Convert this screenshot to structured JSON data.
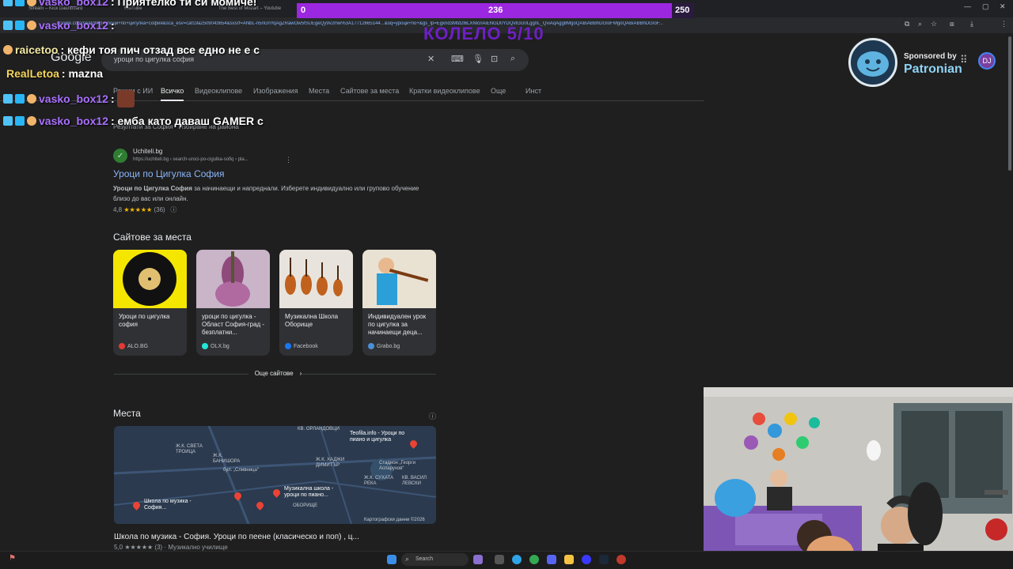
{
  "browser": {
    "tabs": [
      "Stream – Kick Dashboard",
      "YouTube",
      "The Best of Mozart – Youtube"
    ],
    "url": "google.com/search?q=уроци+по+цигулка+софия&sca_esv=caf19a2509043654&sxsrf=ANbL-n5nGnYqAgZRawOw5fSUEgeQy9v2mw%3A17712665144...&oq=уроци+по+&gs_lp=Egxnd3Mtd2l6LXNlcnAiENGD0YDQvtGG0Lgg0L_QviAqAgg8MgoQABiABBhDGIoFMgoQABiABBhDGIoF..."
  },
  "search": {
    "logo": "Google",
    "query": "уроци по цигулка софия",
    "tabs": [
      "Режим с ИИ",
      "Всичко",
      "Видеоклипове",
      "Изображения",
      "Места",
      "Сайтове за места",
      "Кратки видеоклипове",
      "Още",
      "Инст"
    ],
    "results_for": "Резултати за София · Избиране на района"
  },
  "result1": {
    "site": "Uchiteli.bg",
    "url": "https://uchiteli.bg › search-uroci-po-cigulka-sofiq › pla...",
    "title": "Уроци по Цигулка София",
    "snippet_bold": "Уроци по Цигулка София",
    "snippet": " за начинаещи и напреднали. Изберете индивидуално или групово обучение близо до вас или онлайн.",
    "rating_value": "4,8",
    "stars": "★★★★★",
    "rating_count": "(36)"
  },
  "places_sites": {
    "title": "Сайтове за места",
    "cards": [
      {
        "title": "Уроци по цигулка софия",
        "source": "ALO.BG",
        "dot": "#e53935"
      },
      {
        "title": "уроци по цигулка - Област София-град - безплатни...",
        "source": "OLX.bg",
        "dot": "#23e5db"
      },
      {
        "title": "Музикална Школа Оборище",
        "source": "Facebook",
        "dot": "#1877f2"
      },
      {
        "title": "Индивидуален урок по цигулка за начинаещи деца...",
        "source": "Grabo.bg",
        "dot": "#4a90d9"
      }
    ],
    "more": "Още сайтове"
  },
  "places": {
    "title": "Места",
    "map_labels": [
      "КВ. ОРЛАНДОВЦИ",
      "Ж.К. СВЕТА ТРОИЦА",
      "Ж.К. БАНИШОРА",
      "Ж.К. ХАДЖИ ДИМИТЪР",
      "бул. „Сливница“",
      "Стадион „Георги Аспарухов“",
      "Ж.К. СУХАТА РЕКА",
      "КВ. ВАСИЛ ЛЕВСКИ",
      "ОБОРИЩЕ",
      "Картографски данни ©2026"
    ],
    "map_places": [
      "Teofila.info - Уроци по пиано и цигулка",
      "Музикална школа - уроци по пиано...",
      "Школа по музика - София..."
    ],
    "bottom_title": "Школа по музика - София. Уроци по пеене (класическо и поп) , ц...",
    "bottom_rating": "5,0 ★★★★★ (3) · Музикално училище"
  },
  "overlay": {
    "chat": [
      {
        "user": "vasko_box12",
        "msg": ": Приятелко ти си момиче!"
      },
      {
        "user": "vasko_box12",
        "msg": ": "
      },
      {
        "user": "raicetoo",
        "msg": ": кефи тоя пич отзад все едно не е с"
      },
      {
        "user": "RealLetoa",
        "msg": ": mazna"
      },
      {
        "user": "vasko_box12",
        "msg": ": "
      },
      {
        "user": "vasko_box12",
        "msg": ": емба като даваш GAMER с"
      }
    ],
    "progress": {
      "current": "0",
      "value": "236",
      "goal": "250",
      "fraction": 0.944
    },
    "wheel": "КОЛЕЛО 5/10",
    "sponsor_by": "Sponsored by",
    "sponsor_name": "Patronian"
  },
  "taskbar": {
    "search": "Search"
  }
}
